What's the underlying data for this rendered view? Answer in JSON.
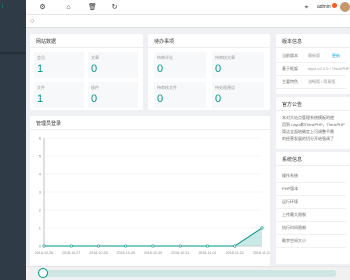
{
  "topbar": {
    "user_label": "admin",
    "badge": "admin"
  },
  "sidebar": {
    "items": [
      {
        "label": "i"
      },
      {
        "label": ""
      },
      {
        "label": ""
      },
      {
        "label": ""
      },
      {
        "label": ""
      },
      {
        "label": ""
      }
    ]
  },
  "site_data": {
    "title": "网站数据",
    "stats": [
      {
        "label": "会员",
        "value": "1"
      },
      {
        "label": "文章",
        "value": "0"
      },
      {
        "label": "文件",
        "value": "1"
      },
      {
        "label": "插件",
        "value": "0"
      }
    ]
  },
  "pending": {
    "title": "待办事项",
    "stats": [
      {
        "label": "待审评论",
        "value": "0"
      },
      {
        "label": "待审核文章",
        "value": "0"
      },
      {
        "label": "待审核文件",
        "value": "0"
      },
      {
        "label": "待处理建议",
        "value": "0"
      }
    ]
  },
  "version": {
    "title": "版本信息",
    "rows": [
      {
        "key": "当前版本",
        "value": "最新版",
        "extra": "更新"
      },
      {
        "key": "基于框架",
        "value": "layui-v2.2.5 / ThinkPHP"
      },
      {
        "key": "主要特色",
        "value": "流畅版 / 简易版"
      }
    ]
  },
  "notice": {
    "title": "官方公告",
    "text_lines": [
      "本对大站点管理系统模板的使",
      "用到 Layui和ThinkPHP，ThinkPHP",
      "简洁全面地确定上可调整不需",
      "的经营发展的切分开始强调了"
    ]
  },
  "sysinfo": {
    "title": "系统信息",
    "rows": [
      {
        "key": "操作系统"
      },
      {
        "key": "PHP版本"
      },
      {
        "key": "运行环境"
      },
      {
        "key": "上传最大限制"
      },
      {
        "key": "执行时间限制"
      },
      {
        "key": "剩余空间大小"
      }
    ]
  },
  "trend": {
    "title": "管理员登录"
  },
  "chart_data": {
    "type": "line",
    "title": "",
    "xlabel": "",
    "ylabel": "",
    "categories": [
      "2018-10-26",
      "2018-10-27",
      "2018-10-28",
      "2018-10-29",
      "2018-10-30",
      "2018-10-31",
      "2018-11-01",
      "2018-11-02",
      "2018-11-03"
    ],
    "y_ticks": [
      "0",
      "1",
      "2",
      "3",
      "4",
      "5",
      "6"
    ],
    "ylim": [
      0,
      6
    ],
    "series": [
      {
        "values": [
          0,
          0,
          0,
          0,
          0,
          0,
          0,
          0,
          1
        ]
      }
    ],
    "grid": true,
    "colors": {
      "line": "#009688",
      "area": "#b2dfdb"
    }
  }
}
